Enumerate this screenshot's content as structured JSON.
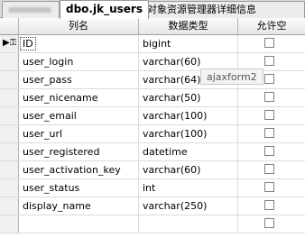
{
  "tabs": {
    "blurred_label": "",
    "active_label": "dbo.jk_users",
    "third_label": "对象资源管理器详细信息"
  },
  "columns": {
    "name": "列名",
    "type": "数据类型",
    "nullable": "允许空"
  },
  "rows": [
    {
      "name": "ID",
      "type": "bigint"
    },
    {
      "name": "user_login",
      "type": "varchar(60)"
    },
    {
      "name": "user_pass",
      "type": "varchar(64)"
    },
    {
      "name": "user_nicename",
      "type": "varchar(50)"
    },
    {
      "name": "user_email",
      "type": "varchar(100)"
    },
    {
      "name": "user_url",
      "type": "varchar(100)"
    },
    {
      "name": "user_registered",
      "type": "datetime"
    },
    {
      "name": "user_activation_key",
      "type": "varchar(60)"
    },
    {
      "name": "user_status",
      "type": "int"
    },
    {
      "name": "display_name",
      "type": "varchar(250)"
    },
    {
      "name": "",
      "type": ""
    }
  ],
  "tooltip": "ajaxform2",
  "icons": {
    "row_indicator": "primary-key-icon",
    "checkbox": "checkbox-unchecked-icon"
  }
}
